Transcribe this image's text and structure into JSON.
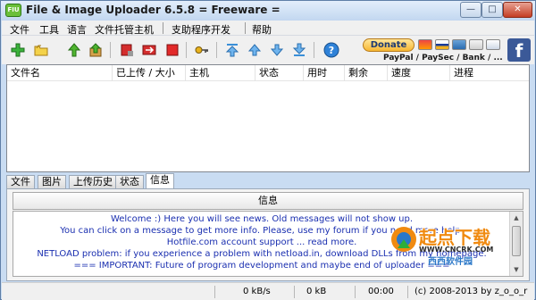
{
  "window": {
    "title": "File & Image Uploader 6.5.8  = Freeware =",
    "app_icon_text": "FIU"
  },
  "menu": [
    "文件",
    "工具",
    "语言",
    "文件托管主机",
    "支助程序开发",
    "帮助"
  ],
  "toolbar": {
    "buttons": [
      "add-files-icon",
      "open-folder-icon",
      "upload-icon",
      "upload-all-icon",
      "stop-icon",
      "forward-icon",
      "stop-all-icon",
      "key-icon",
      "move-top-icon",
      "move-up-icon",
      "move-down-icon",
      "move-bottom-icon",
      "help-icon"
    ],
    "donate_label": "Donate",
    "payment_caption": "PayPal / PaySec / Bank / ...",
    "facebook_label": "f"
  },
  "upload_list": {
    "columns": [
      "文件名",
      "已上传 / 大小",
      "主机",
      "状态",
      "用时",
      "剩余",
      "速度",
      "进程"
    ]
  },
  "tabs": [
    "文件",
    "图片",
    "上传历史",
    "状态",
    "信息"
  ],
  "active_tab": "信息",
  "info_panel": {
    "title": "信息",
    "news": [
      "Welcome :) Here you will see news. Old messages will not show up.",
      "You can click on a message to get more info. Please, use my forum if you need more help.",
      "Hotfile.com account support ... read more.",
      "NETLOAD problem: if you experience a problem with netload.in, download DLLs from my homepage.",
      "=== IMPORTANT: Future of program development and maybe end of uploader ==="
    ]
  },
  "statusbar": {
    "speed": "0 kB/s",
    "size": "0 kB",
    "time": "00:00",
    "copyright": "(c) 2008-2013 by z_o_o_r"
  },
  "watermark": {
    "main": "起点下载",
    "url": "WWW.CNCRK.COM",
    "sub": "西西软件园"
  },
  "colors": {
    "title_bg": "#c9dcf2",
    "news_text": "#1a2fb0",
    "facebook": "#3b5998",
    "close_button": "#c43d23"
  }
}
